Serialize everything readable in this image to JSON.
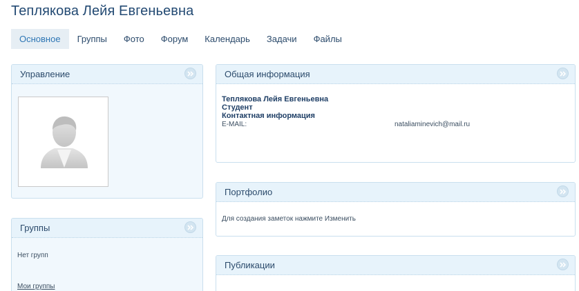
{
  "profile": {
    "full_name": "Теплякова Лейя Евгеньевна"
  },
  "tabs": [
    {
      "label": "Основное",
      "active": true
    },
    {
      "label": "Группы"
    },
    {
      "label": "Фото"
    },
    {
      "label": "Форум"
    },
    {
      "label": "Календарь"
    },
    {
      "label": "Задачи"
    },
    {
      "label": "Файлы"
    }
  ],
  "panels": {
    "management": {
      "title": "Управление"
    },
    "groups": {
      "title": "Группы",
      "empty_text": "Нет групп",
      "link": "Мои группы"
    },
    "general": {
      "title": "Общая информация",
      "name": "Теплякова Лейя Евгеньевна",
      "status": "Студент",
      "contacts_heading": "Контактная информация",
      "email_label": "E-MAIL:",
      "email_value": "nataliaminevich@mail.ru"
    },
    "portfolio": {
      "title": "Портфолио",
      "hint": "Для создания заметок нажмите Изменить"
    },
    "publications": {
      "title": "Публикации"
    }
  },
  "colors": {
    "accent": "#2f77b5",
    "panel_header": "#e7f3fb",
    "panel_border": "#c9dfee",
    "title_text": "#234a73"
  },
  "icons": {
    "collapse": "double-chevron-icon",
    "avatar": "default-user-silhouette-icon"
  }
}
